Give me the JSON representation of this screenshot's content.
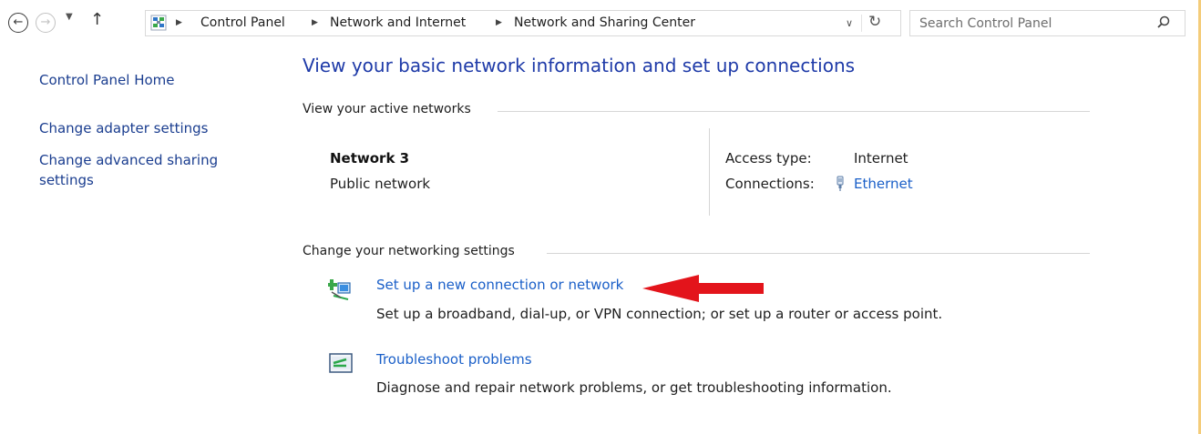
{
  "address_bar": {
    "breadcrumbs": [
      "Control Panel",
      "Network and Internet",
      "Network and Sharing Center"
    ]
  },
  "search": {
    "placeholder": "Search Control Panel",
    "value": ""
  },
  "left_nav": {
    "items": [
      "Control Panel Home",
      "Change adapter settings",
      "Change advanced sharing settings"
    ]
  },
  "main": {
    "title": "View your basic network information and set up connections",
    "active_networks": {
      "heading": "View your active networks",
      "network_name": "Network  3",
      "network_type": "Public network",
      "access_type_label": "Access type:",
      "access_type_value": "Internet",
      "connections_label": "Connections:",
      "connections_value": "Ethernet"
    },
    "settings": {
      "heading": "Change your networking settings",
      "tasks": [
        {
          "link": "Set up a new connection or network",
          "description": "Set up a broadband, dial-up, or VPN connection; or set up a router or access point.",
          "icon": "new-connection-icon"
        },
        {
          "link": "Troubleshoot problems",
          "description": "Diagnose and repair network problems, or get troubleshooting information.",
          "icon": "troubleshoot-icon"
        }
      ]
    }
  },
  "colors": {
    "link": "#1a5fc8",
    "title": "#1e3aa8",
    "nav_link": "#1a3d8f",
    "annotation_arrow": "#e3141b"
  }
}
